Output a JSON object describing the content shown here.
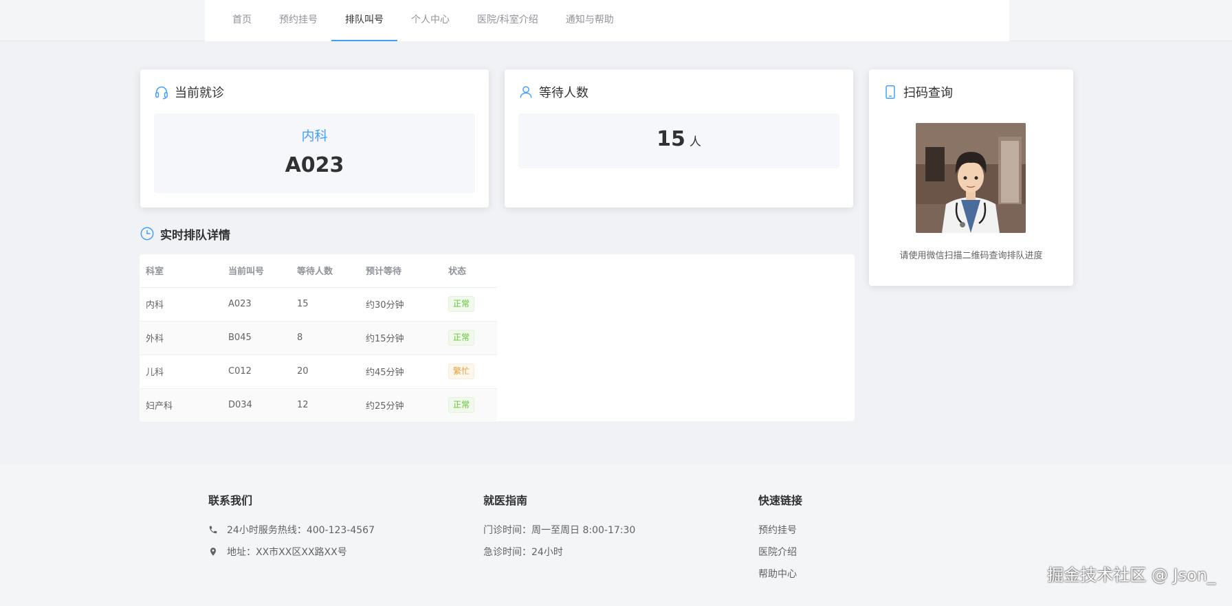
{
  "nav": {
    "items": [
      {
        "label": "首页"
      },
      {
        "label": "预约挂号"
      },
      {
        "label": "排队叫号"
      },
      {
        "label": "个人中心"
      },
      {
        "label": "医院/科室介绍"
      },
      {
        "label": "通知与帮助"
      }
    ],
    "active_index": 2
  },
  "current_card": {
    "title": "当前就诊",
    "icon": "headset-icon",
    "department": "内科",
    "number": "A023"
  },
  "waiting_card": {
    "title": "等待人数",
    "icon": "user-icon",
    "count": "15",
    "unit": "人"
  },
  "qr_card": {
    "title": "扫码查询",
    "icon": "mobile-icon",
    "image": "doctor-portrait",
    "hint": "请使用微信扫描二维码查询排队进度"
  },
  "queue_section": {
    "title": "实时排队详情",
    "icon": "clock-icon",
    "columns": [
      "科室",
      "当前叫号",
      "等待人数",
      "预计等待",
      "状态"
    ],
    "rows": [
      {
        "dept": "内科",
        "current": "A023",
        "waiting": "15",
        "eta": "约30分钟",
        "status": "正常",
        "status_type": "success"
      },
      {
        "dept": "外科",
        "current": "B045",
        "waiting": "8",
        "eta": "约15分钟",
        "status": "正常",
        "status_type": "success"
      },
      {
        "dept": "儿科",
        "current": "C012",
        "waiting": "20",
        "eta": "约45分钟",
        "status": "繁忙",
        "status_type": "warning"
      },
      {
        "dept": "妇产科",
        "current": "D034",
        "waiting": "12",
        "eta": "约25分钟",
        "status": "正常",
        "status_type": "success"
      }
    ]
  },
  "footer": {
    "contact": {
      "title": "联系我们",
      "hotline": "24小时服务热线：400-123-4567",
      "address": "地址：XX市XX区XX路XX号",
      "hotline_icon": "phone-icon",
      "address_icon": "location-icon"
    },
    "guide": {
      "title": "就医指南",
      "hours": "门诊时间：周一至周日 8:00-17:30",
      "emergency": "急诊时间：24小时"
    },
    "links": {
      "title": "快速链接",
      "items": [
        "预约挂号",
        "医院介绍",
        "帮助中心"
      ]
    }
  },
  "watermark": "掘金技术社区 @ Json_",
  "colors": {
    "primary": "#409eff",
    "success": "#67c23a",
    "warning": "#e6a23c"
  }
}
